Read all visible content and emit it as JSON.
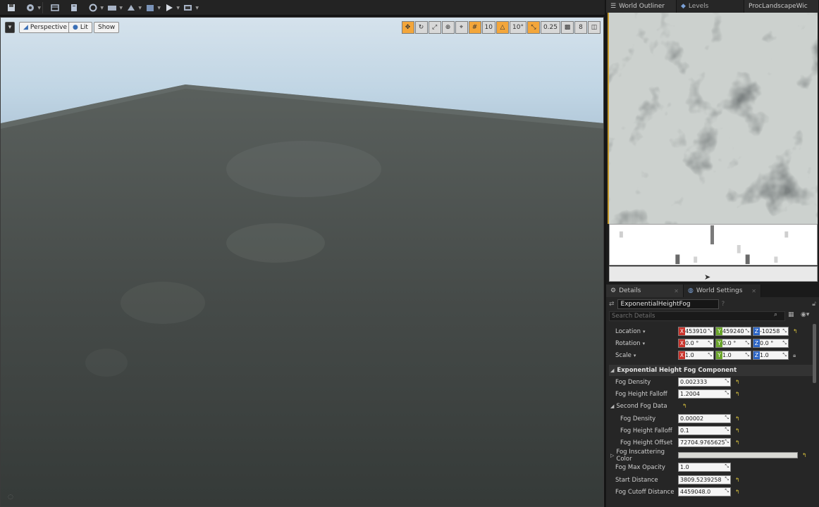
{
  "toolbar": {
    "icons": [
      "save-icon",
      "content-icon",
      "marketplace-icon",
      "settings-icon",
      "blueprints-icon",
      "cinematics-icon",
      "build-icon",
      "play-icon",
      "launch-icon"
    ]
  },
  "viewport": {
    "perspective_label": "Perspective",
    "lit_label": "Lit",
    "show_label": "Show",
    "grid_snap_value": "10",
    "rotation_snap_value": "10°",
    "scale_snap_value": "0.25",
    "camera_speed_value": "8"
  },
  "tabs_top": {
    "world_outliner": "World Outliner",
    "levels": "Levels",
    "proc_landscape": "ProcLandscapeWic"
  },
  "details": {
    "tab_details": "Details",
    "tab_world_settings": "World Settings",
    "actor_name": "ExponentialHeightFog",
    "search_placeholder": "Search Details",
    "transform": {
      "location_label": "Location",
      "rotation_label": "Rotation",
      "scale_label": "Scale",
      "location": [
        "453910",
        "459240",
        "-10258"
      ],
      "rotation": [
        "0.0 °",
        "0.0 °",
        "0.0 °"
      ],
      "scale": [
        "1.0",
        "1.0",
        "1.0"
      ]
    },
    "category": "Exponential Height Fog Component",
    "props": {
      "fog_density_label": "Fog Density",
      "fog_density": "0.002333",
      "fog_height_falloff_label": "Fog Height Falloff",
      "fog_height_falloff": "1.2004",
      "second_fog_data_label": "Second Fog Data",
      "second_fog_density_label": "Fog Density",
      "second_fog_density": "0.00002",
      "second_fog_height_falloff_label": "Fog Height Falloff",
      "second_fog_height_falloff": "0.1",
      "fog_height_offset_label": "Fog Height Offset",
      "fog_height_offset": "72704.9765625",
      "fog_inscattering_color_label": "Fog Inscattering Color",
      "fog_max_opacity_label": "Fog Max Opacity",
      "fog_max_opacity": "1.0",
      "start_distance_label": "Start Distance",
      "start_distance": "3809.5239258",
      "fog_cutoff_distance_label": "Fog Cutoff Distance",
      "fog_cutoff_distance": "4459048.0"
    }
  },
  "colors": {
    "accent": "#f3a63b",
    "axis_x": "#c9332b",
    "axis_y": "#6ba52b",
    "axis_z": "#2c65c5",
    "panel": "#262626"
  }
}
